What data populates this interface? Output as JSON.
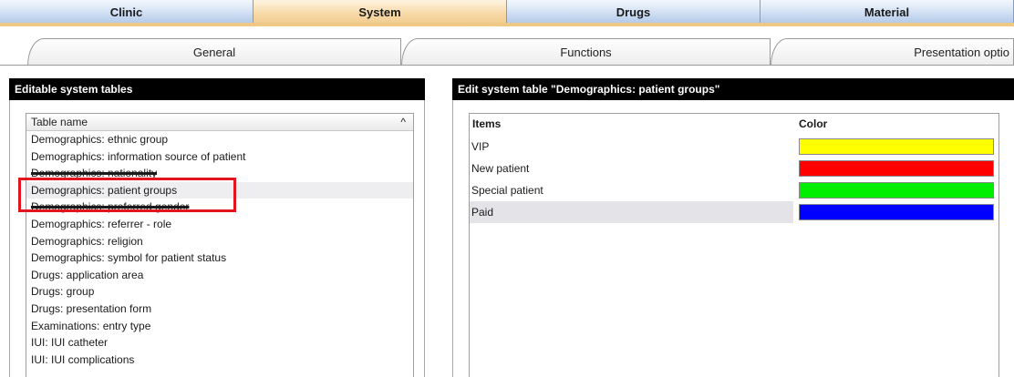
{
  "top_tabs": [
    {
      "label": "Clinic",
      "active": false
    },
    {
      "label": "System",
      "active": true
    },
    {
      "label": "Drugs",
      "active": false
    },
    {
      "label": "Material",
      "active": false
    }
  ],
  "sub_tabs": {
    "general": "General",
    "functions": "Functions",
    "presentation": "Presentation optio"
  },
  "left_panel": {
    "title": "Editable system tables",
    "column_header": "Table name",
    "sort_icon": "^",
    "items": [
      "Demographics: ethnic group",
      "Demographics: information source of patient",
      "Demographics: nationality",
      "Demographics: patient groups",
      "Demographics: preferred gender",
      "Demographics: referrer - role",
      "Demographics: religion",
      "Demographics: symbol for patient status",
      "Drugs: application area",
      "Drugs: group",
      "Drugs: presentation form",
      "Examinations: entry type",
      "IUI: IUI catheter",
      "IUI: IUI complications"
    ],
    "selected_index": 3
  },
  "right_panel": {
    "title": "Edit system table \"Demographics: patient groups\"",
    "columns": {
      "items": "Items",
      "color": "Color"
    },
    "rows": [
      {
        "item": "VIP",
        "color": "#ffff00"
      },
      {
        "item": "New patient",
        "color": "#ff0000"
      },
      {
        "item": "Special patient",
        "color": "#00ee00"
      },
      {
        "item": "Paid",
        "color": "#0000ff"
      }
    ]
  },
  "colors": {
    "highlight": "#e2141e",
    "tab_active": "#f6d7a4",
    "tab_inactive": "#a9c3e6"
  }
}
